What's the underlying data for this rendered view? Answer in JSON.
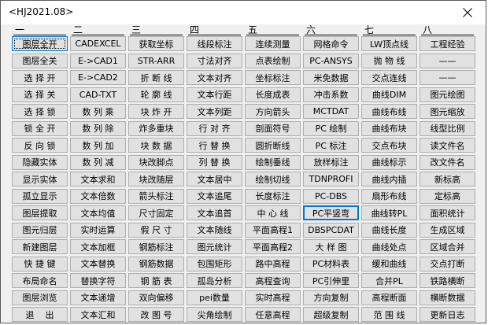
{
  "window": {
    "title": "<HJ2021.08>"
  },
  "columns": [
    "一",
    "二",
    "三",
    "四",
    "五",
    "六",
    "七",
    "八"
  ],
  "rows": [
    [
      "图层全开",
      "CADEXCEL",
      "获取坐标",
      "线段标注",
      "连续测量",
      "网格命令",
      "LW顶点线",
      "工程经验"
    ],
    [
      "图层全关",
      "E->CAD1",
      "STR-ARR",
      "寸法对齐",
      "点表绘制",
      "PC-ANSYS",
      "抛 物 线",
      "——"
    ],
    [
      "选 择 开",
      "E->CAD2",
      "折 断 线",
      "文本对齐",
      "坐标标注",
      "米免数据",
      "交点连线",
      "——"
    ],
    [
      "选 择 关",
      "CAD-TXT",
      "轮 廓 线",
      "文本行距",
      "长度成表",
      "冲击系数",
      "曲线DIM",
      "图元绘图"
    ],
    [
      "选 择 锁",
      "数 列 乘",
      "块 炸 开",
      "文本列距",
      "方向箭头",
      "MCTDAT",
      "曲线布线",
      "图元缩放"
    ],
    [
      "锁 全 开",
      "数 列 除",
      "炸多重块",
      "行 对 齐",
      "剖面符号",
      "PC 绘制",
      "曲线布块",
      "线型比例"
    ],
    [
      "反 向 锁",
      "数 列 加",
      "块 数 据",
      "行 替 换",
      "圆折断线",
      "PC 标注",
      "交点布块",
      "读文件名"
    ],
    [
      "隐藏实体",
      "数 列 减",
      "块改脚点",
      "列 替 换",
      "绘制垂线",
      "放样标注",
      "曲线标示",
      "改文件名"
    ],
    [
      "显示实体",
      "文本求和",
      "块改随层",
      "文本居中",
      "绘制切线",
      "TDNPROFI",
      "曲线内插",
      "新标高"
    ],
    [
      "孤立显示",
      "文本倍数",
      "箭头标注",
      "文本追尾",
      "长度标注",
      "PC-DBS",
      "扇形布线",
      "定标高"
    ],
    [
      "图层提取",
      "文本均值",
      "尺寸固定",
      "文本追首",
      "中 心 线",
      "PC平竖弯",
      "曲线转PL",
      "面积统计"
    ],
    [
      "图元归层",
      "实时运算",
      "假 尺 寸",
      "文本随线",
      "平面高程1",
      "DBSPCDAT",
      "曲线长度",
      "生成区域"
    ],
    [
      "新建图层",
      "文本加框",
      "钢筋标注",
      "图元统计",
      "平面高程2",
      "大 样 图",
      "曲线处点",
      "区域合并"
    ],
    [
      "快 捷 键",
      "文本替换",
      "钢筋数据",
      "包围矩形",
      "路中高程",
      "PC材料表",
      "缓和曲线",
      "交点打断"
    ],
    [
      "布局命名",
      "替换字符",
      "钢 筋 表",
      "孤岛分析",
      "高程查询",
      "PC引伸里",
      "合并PL",
      "铁路横断"
    ],
    [
      "图层浏览",
      "文本递增",
      "双向偏移",
      "pei数量",
      "实时高程",
      "方向复制",
      "高程断面",
      "横断数据"
    ],
    [
      "退    出",
      "文本汇和",
      "改 图 号",
      "尖角绘制",
      "任意高程",
      "超级复制",
      "范 围 线",
      "更新日志"
    ]
  ]
}
